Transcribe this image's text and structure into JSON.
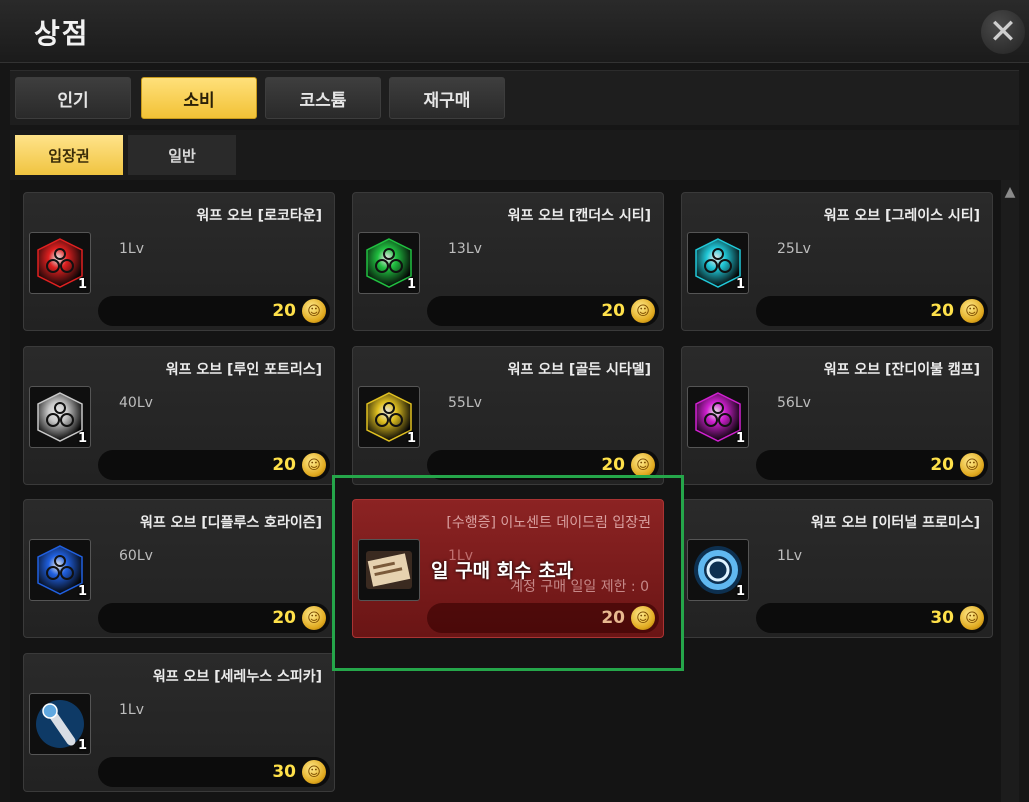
{
  "window": {
    "title": "상점",
    "close_label": "✕"
  },
  "tabs": [
    {
      "label": "인기",
      "active": false
    },
    {
      "label": "소비",
      "active": true
    },
    {
      "label": "코스튬",
      "active": false
    },
    {
      "label": "재구매",
      "active": false
    }
  ],
  "subtabs": [
    {
      "label": "입장권",
      "active": true
    },
    {
      "label": "일반",
      "active": false
    }
  ],
  "items": [
    {
      "name": "워프 오브 [로코타운]",
      "level": "1Lv",
      "qty": "1",
      "price": "20",
      "icon": "warp-orb-red-icon",
      "color": "#e02020"
    },
    {
      "name": "워프 오브 [캔더스 시티]",
      "level": "13Lv",
      "qty": "1",
      "price": "20",
      "icon": "warp-orb-green-icon",
      "color": "#20c040"
    },
    {
      "name": "워프 오브 [그레이스 시티]",
      "level": "25Lv",
      "qty": "1",
      "price": "20",
      "icon": "warp-orb-cyan-icon",
      "color": "#20c8d8"
    },
    {
      "name": "워프 오브 [루인 포트리스]",
      "level": "40Lv",
      "qty": "1",
      "price": "20",
      "icon": "warp-orb-white-icon",
      "color": "#c8c8c8"
    },
    {
      "name": "워프 오브 [골든 시타델]",
      "level": "55Lv",
      "qty": "1",
      "price": "20",
      "icon": "warp-orb-gold-icon",
      "color": "#e0c020"
    },
    {
      "name": "워프 오브 [잔디이불 캠프]",
      "level": "56Lv",
      "qty": "1",
      "price": "20",
      "icon": "warp-orb-magenta-icon",
      "color": "#d020d0"
    },
    {
      "name": "워프 오브 [디플루스 호라이즌]",
      "level": "60Lv",
      "qty": "1",
      "price": "20",
      "icon": "warp-orb-blue-icon",
      "color": "#2060e0"
    },
    {
      "name": "[수행증] 이노센트 데이드림 입장권",
      "level": "1Lv",
      "qty": "",
      "price": "20",
      "icon": "ticket-icon",
      "color": "#c8a070",
      "disabled": true,
      "overlay": "일 구매 회수 초과",
      "limit": "계정 구매 일일 제한 : 0"
    },
    {
      "name": "워프 오브 [이터널 프로미스]",
      "level": "1Lv",
      "qty": "1",
      "price": "30",
      "icon": "warp-ring-icon",
      "color": "#60b8f0"
    },
    {
      "name": "워프 오브 [세레누스 스피카]",
      "level": "1Lv",
      "qty": "1",
      "price": "30",
      "icon": "warp-wand-icon",
      "color": "#60a8e0"
    }
  ]
}
